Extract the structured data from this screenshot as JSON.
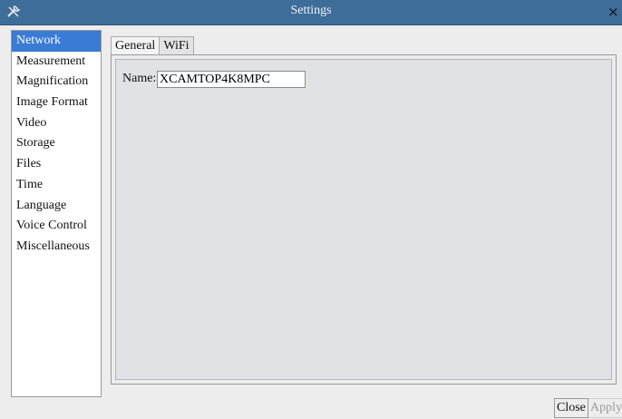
{
  "window": {
    "title": "Settings",
    "app_icon": "tools-icon",
    "close_glyph": "×"
  },
  "sidebar": {
    "items": [
      {
        "label": "Network",
        "selected": true
      },
      {
        "label": "Measurement",
        "selected": false
      },
      {
        "label": "Magnification",
        "selected": false
      },
      {
        "label": "Image Format",
        "selected": false
      },
      {
        "label": "Video",
        "selected": false
      },
      {
        "label": "Storage",
        "selected": false
      },
      {
        "label": "Files",
        "selected": false
      },
      {
        "label": "Time",
        "selected": false
      },
      {
        "label": "Language",
        "selected": false
      },
      {
        "label": "Voice Control",
        "selected": false
      },
      {
        "label": "Miscellaneous",
        "selected": false
      }
    ]
  },
  "tabs": [
    {
      "label": "General",
      "active": true
    },
    {
      "label": "WiFi",
      "active": false
    }
  ],
  "general": {
    "name_label": "Name:",
    "name_value": "XCAMTOP4K8MPC"
  },
  "footer": {
    "close_label": "Close",
    "apply_label": "Apply"
  },
  "colors": {
    "titlebar": "#3e6d9a",
    "selection": "#3a7bd5",
    "panel": "#e1e2e5"
  }
}
